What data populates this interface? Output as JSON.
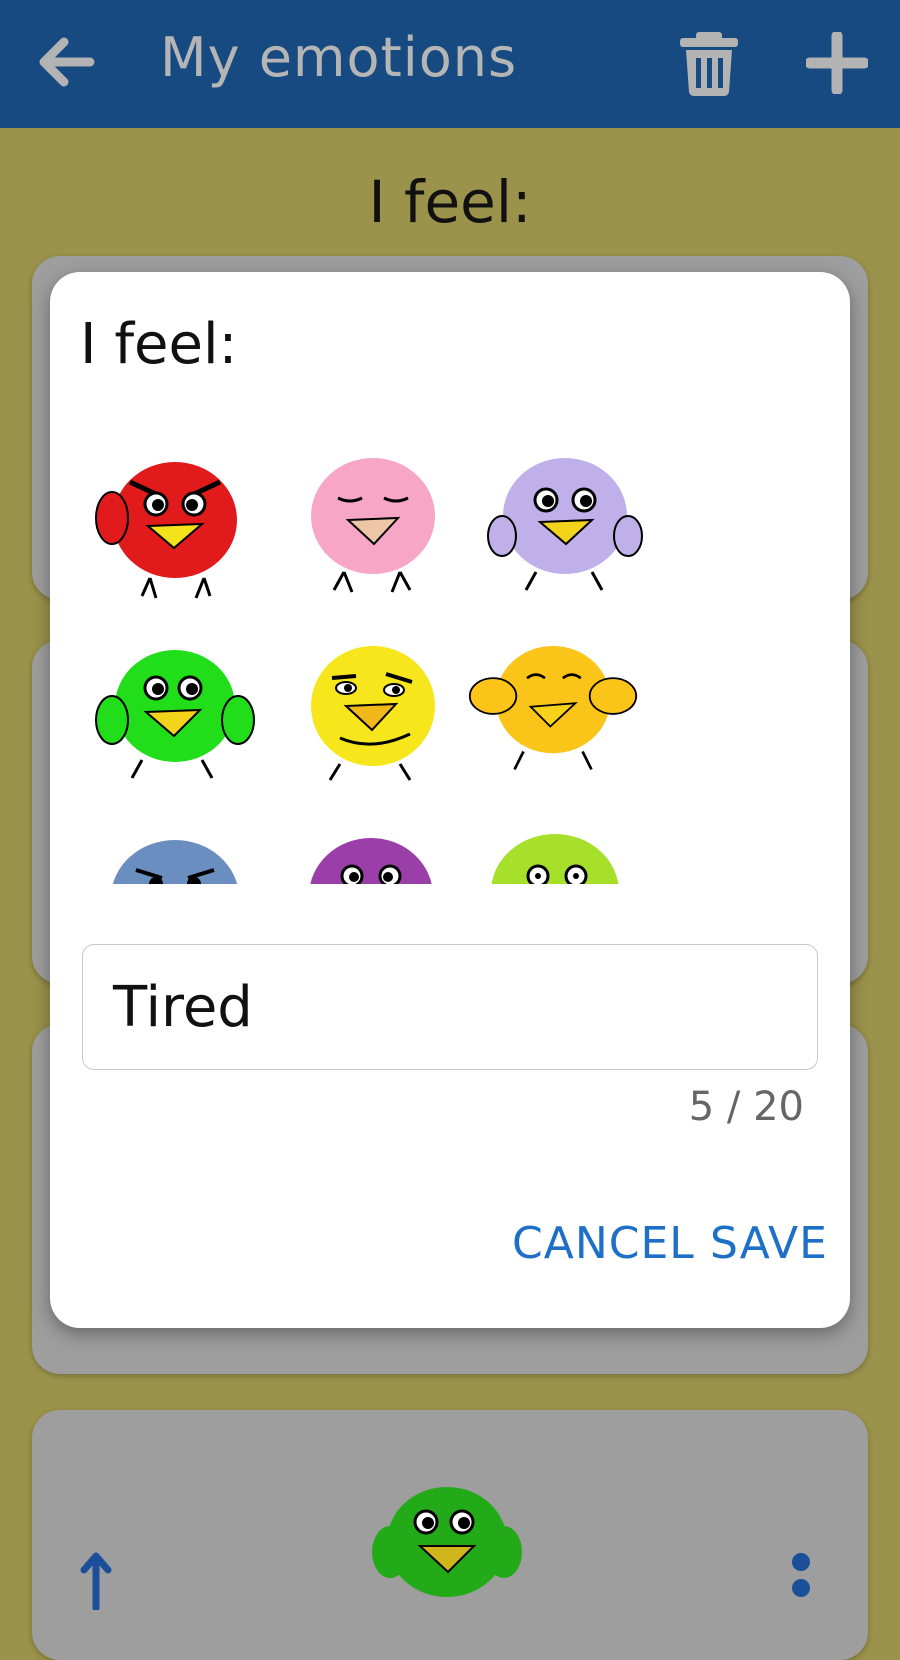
{
  "appbar": {
    "title": "My emotions",
    "back_icon": "arrow-left-icon",
    "delete_icon": "trash-icon",
    "add_icon": "plus-icon",
    "color": "#164a80"
  },
  "page": {
    "heading": "I feel:"
  },
  "dialog": {
    "title": "I feel:",
    "emotions": [
      {
        "name": "angry-bird",
        "color": "#e11b1b"
      },
      {
        "name": "calm-bird",
        "color": "#f7a6c6"
      },
      {
        "name": "surprised-bird",
        "color": "#bfb0ea"
      },
      {
        "name": "happy-bird",
        "color": "#22dd1a"
      },
      {
        "name": "thinking-bird",
        "color": "#f8e61c"
      },
      {
        "name": "joyful-bird",
        "color": "#fbc419"
      },
      {
        "name": "grumpy-bird",
        "color": "#6b8ec0"
      },
      {
        "name": "sad-bird",
        "color": "#9b3fa8"
      },
      {
        "name": "amazed-bird",
        "color": "#a7e02a"
      }
    ],
    "input_value": "Tired",
    "counter": "5 / 20",
    "cancel_label": "CANCEL",
    "save_label": "SAVE"
  },
  "background_list": {
    "move_icon": "arrow-up-icon",
    "more_icon": "more-vertical-icon",
    "item_bird": "happy-bird"
  }
}
